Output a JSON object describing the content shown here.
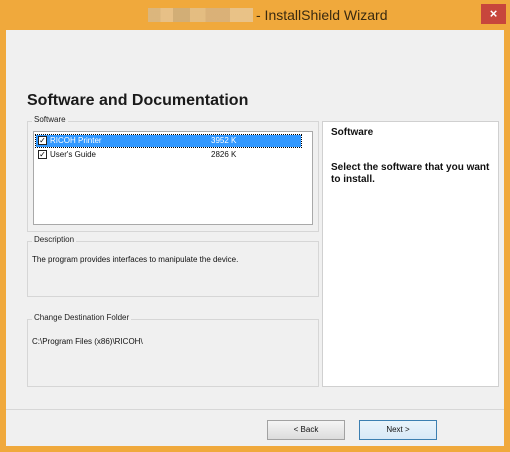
{
  "window": {
    "title": "- InstallShield Wizard",
    "close_glyph": "×",
    "accent_color": "#f0a93c"
  },
  "page": {
    "heading": "Software and Documentation"
  },
  "software": {
    "group_label": "Software",
    "items": [
      {
        "name": "RICOH Printer",
        "size": "3952 K",
        "checked": true,
        "selected": true
      },
      {
        "name": "User's Guide",
        "size": "2826 K",
        "checked": true,
        "selected": false
      }
    ]
  },
  "description": {
    "group_label": "Description",
    "text": "The program provides interfaces to manipulate the device."
  },
  "destination": {
    "group_label": "Change Destination Folder",
    "path": "C:\\Program Files (x86)\\RICOH\\"
  },
  "info": {
    "title": "Software",
    "body": "Select the software that you want to install."
  },
  "buttons": {
    "back": "< Back",
    "next": "Next >"
  }
}
